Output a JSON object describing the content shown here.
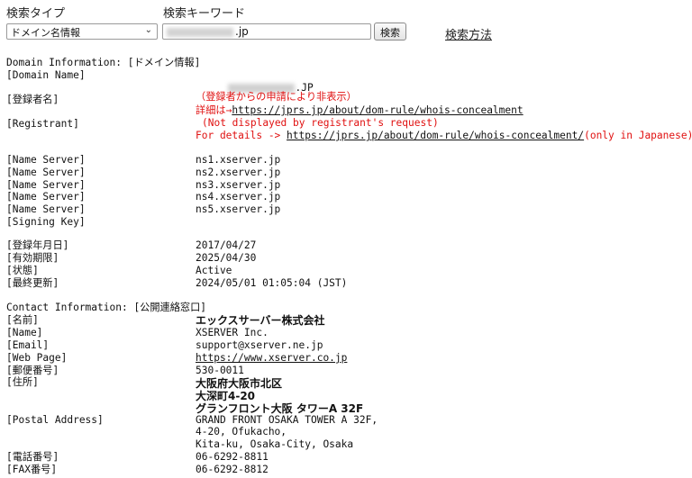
{
  "header": {
    "search_type_label": "検索タイプ",
    "keyword_label": "検索キーワード",
    "search_type_value": "ドメイン名情報",
    "keyword_suffix": ".jp",
    "search_button": "検索",
    "howto_link": "検索方法"
  },
  "domain": {
    "info_heading": "Domain Information: [ドメイン情報]",
    "name_label": "[Domain Name]",
    "name_suffix": ".JP"
  },
  "registrant": {
    "label_ja": "[登録者名]",
    "label_en": "[Registrant]",
    "notice_ja": "（登録者からの申請により非表示）",
    "details_ja_prefix": "詳細は→",
    "details_url": "https://jprs.jp/about/dom-rule/whois-concealment",
    "notice_en": "(Not displayed by registrant's request)",
    "details_en_prefix": "For details -> ",
    "details_en_url": "https://jprs.jp/about/dom-rule/whois-concealment/",
    "details_en_suffix": "(only in Japanese)"
  },
  "name_servers": {
    "label": "[Name Server]",
    "values": [
      "ns1.xserver.jp",
      "ns2.xserver.jp",
      "ns3.xserver.jp",
      "ns4.xserver.jp",
      "ns5.xserver.jp"
    ],
    "signing_key_label": "[Signing Key]"
  },
  "dates": {
    "registered_label": "[登録年月日]",
    "registered_value": "2017/04/27",
    "expires_label": "[有効期限]",
    "expires_value": "2025/04/30",
    "status_label": "[状態]",
    "status_value": "Active",
    "updated_label": "[最終更新]",
    "updated_value": "2024/05/01 01:05:04 (JST)"
  },
  "contact": {
    "heading": "Contact Information: [公開連絡窓口]",
    "name_ja_label": "[名前]",
    "name_ja_value": "エックスサーバー株式会社",
    "name_label": "[Name]",
    "name_value": "XSERVER Inc.",
    "email_label": "[Email]",
    "email_value": "support@xserver.ne.jp",
    "web_label": "[Web Page]",
    "web_value": "https://www.xserver.co.jp",
    "zip_label": "[郵便番号]",
    "zip_value": "530-0011",
    "address_label": "[住所]",
    "address_lines": [
      "大阪府大阪市北区",
      "大深町4-20",
      "グランフロント大阪 タワーA 32F"
    ],
    "postal_label": "[Postal Address]",
    "postal_lines": [
      "GRAND FRONT OSAKA TOWER A 32F,",
      "4-20, Ofukacho,",
      "Kita-ku, Osaka-City, Osaka"
    ],
    "phone_label": "[電話番号]",
    "phone_value": "06-6292-8811",
    "fax_label": "[FAX番号]",
    "fax_value": "06-6292-8812"
  }
}
